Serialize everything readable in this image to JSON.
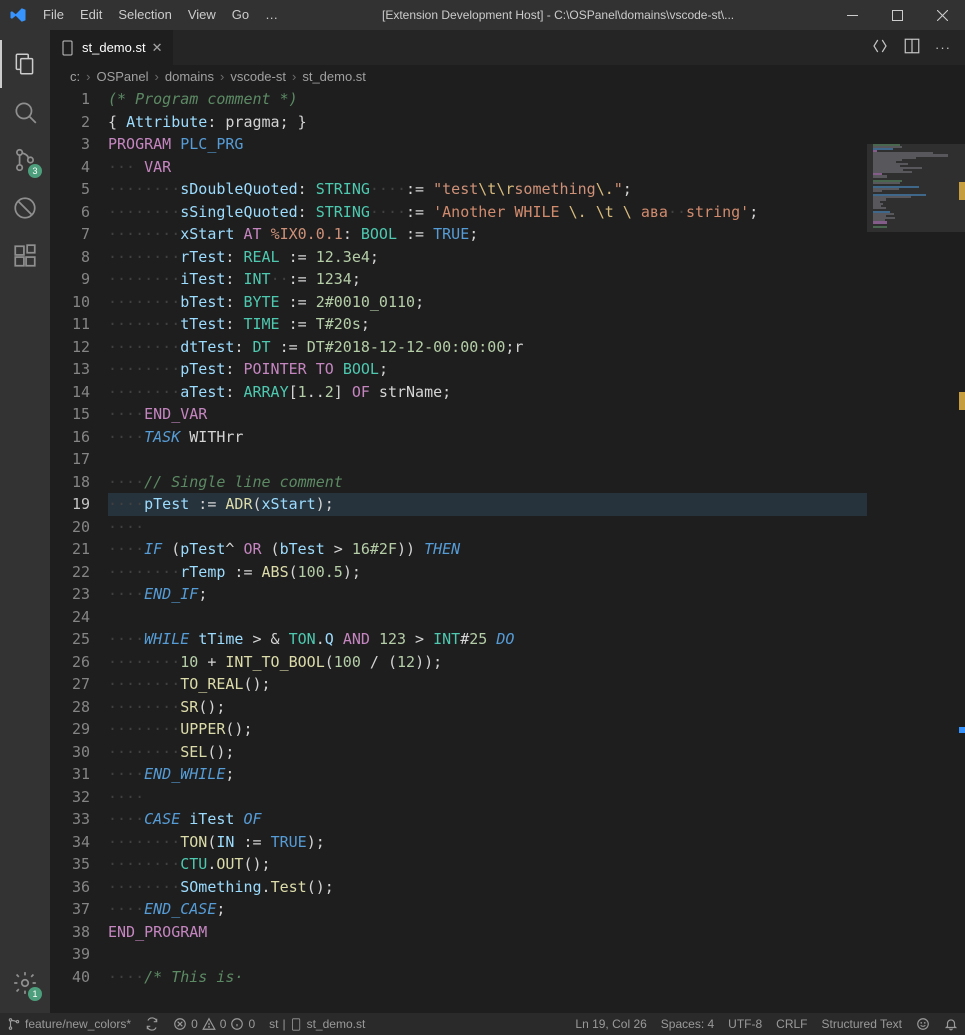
{
  "window": {
    "title": "[Extension Development Host] - C:\\OSPanel\\domains\\vscode-st\\..."
  },
  "menu": {
    "items": [
      "File",
      "Edit",
      "Selection",
      "View",
      "Go"
    ]
  },
  "activitybar": {
    "scm_badge": "3",
    "manage_badge": "1"
  },
  "tab": {
    "name": "st_demo.st"
  },
  "editor_actions": {
    "compare": "Compare changes",
    "split": "Split editor",
    "more": "More"
  },
  "breadcrumbs": [
    "c:",
    "OSPanel",
    "domains",
    "vscode-st",
    "st_demo.st"
  ],
  "code": {
    "lines": [
      {
        "n": 1,
        "raw": [
          [
            "c-comment",
            "(* Program comment *)"
          ]
        ]
      },
      {
        "n": 2,
        "raw": [
          [
            "c-punct",
            "{ "
          ],
          [
            "c-attr",
            "Attribute"
          ],
          [
            "c-punct",
            ": "
          ],
          [
            "c-white",
            "pragma"
          ],
          [
            "c-punct",
            "; }"
          ]
        ]
      },
      {
        "n": 3,
        "raw": [
          [
            "c-key",
            "PROGRAM "
          ],
          [
            "c-type",
            "PLC_PRG"
          ]
        ]
      },
      {
        "n": 4,
        "mod": "blue",
        "raw": [
          [
            "ws",
            "··· "
          ],
          [
            "c-key",
            "VAR"
          ]
        ]
      },
      {
        "n": 5,
        "raw": [
          [
            "ws",
            "········"
          ],
          [
            "c-var",
            "sDoubleQuoted"
          ],
          [
            "c-punct",
            ": "
          ],
          [
            "c-typecyan",
            "STRING"
          ],
          [
            "ws",
            "····"
          ],
          [
            "c-punct",
            ":= "
          ],
          [
            "c-str",
            "\""
          ],
          [
            "c-str",
            "test"
          ],
          [
            "c-esc",
            "\\t\\r"
          ],
          [
            "c-str",
            "something"
          ],
          [
            "c-esc",
            "\\."
          ],
          [
            "c-str",
            "\""
          ],
          [
            "c-punct",
            ";"
          ]
        ]
      },
      {
        "n": 6,
        "mod": "blue",
        "raw": [
          [
            "ws",
            "········"
          ],
          [
            "c-var",
            "sSingleQuoted"
          ],
          [
            "c-punct",
            ": "
          ],
          [
            "c-typecyan",
            "STRING"
          ],
          [
            "ws",
            "····"
          ],
          [
            "c-punct",
            ":= "
          ],
          [
            "c-strs",
            "'Another WHILE "
          ],
          [
            "c-esc",
            "\\."
          ],
          [
            "c-strs",
            " "
          ],
          [
            "c-esc",
            "\\t"
          ],
          [
            "c-strs",
            " "
          ],
          [
            "c-esc",
            "\\"
          ],
          [
            "c-strs",
            " ава"
          ],
          [
            "ws",
            "··"
          ],
          [
            "c-strs",
            "string'"
          ],
          [
            "c-punct",
            ";"
          ]
        ]
      },
      {
        "n": 7,
        "mod": "blue",
        "raw": [
          [
            "ws",
            "········"
          ],
          [
            "c-var",
            "xStart"
          ],
          [
            "c-white",
            " "
          ],
          [
            "c-key",
            "AT"
          ],
          [
            "c-white",
            " "
          ],
          [
            "c-addr",
            "%IX0.0.1"
          ],
          [
            "c-punct",
            ": "
          ],
          [
            "c-typecyan",
            "BOOL"
          ],
          [
            "c-punct",
            " := "
          ],
          [
            "c-type",
            "TRUE"
          ],
          [
            "c-punct",
            ";"
          ]
        ]
      },
      {
        "n": 8,
        "raw": [
          [
            "ws",
            "········"
          ],
          [
            "c-var",
            "rTest"
          ],
          [
            "c-punct",
            ": "
          ],
          [
            "c-typecyan",
            "REAL"
          ],
          [
            "c-punct",
            " := "
          ],
          [
            "c-num",
            "12.3e4"
          ],
          [
            "c-punct",
            ";"
          ]
        ]
      },
      {
        "n": 9,
        "raw": [
          [
            "ws",
            "········"
          ],
          [
            "c-var",
            "iTest"
          ],
          [
            "c-punct",
            ": "
          ],
          [
            "c-typecyan",
            "INT"
          ],
          [
            "ws",
            "··"
          ],
          [
            "c-punct",
            ":= "
          ],
          [
            "c-num",
            "1234"
          ],
          [
            "c-punct",
            ";"
          ]
        ]
      },
      {
        "n": 10,
        "mod": "blue",
        "raw": [
          [
            "ws",
            "········"
          ],
          [
            "c-var",
            "bTest"
          ],
          [
            "c-punct",
            ": "
          ],
          [
            "c-typecyan",
            "BYTE"
          ],
          [
            "c-punct",
            " := "
          ],
          [
            "c-num",
            "2#0010_0110"
          ],
          [
            "c-punct",
            ";"
          ]
        ]
      },
      {
        "n": 11,
        "raw": [
          [
            "ws",
            "········"
          ],
          [
            "c-var",
            "tTest"
          ],
          [
            "c-punct",
            ": "
          ],
          [
            "c-typecyan",
            "TIME"
          ],
          [
            "c-punct",
            " := "
          ],
          [
            "c-num",
            "T#20s"
          ],
          [
            "c-punct",
            ";"
          ]
        ]
      },
      {
        "n": 12,
        "mod": "blue",
        "raw": [
          [
            "ws",
            "········"
          ],
          [
            "c-var",
            "dtTest"
          ],
          [
            "c-punct",
            ": "
          ],
          [
            "c-typecyan",
            "DT"
          ],
          [
            "c-punct",
            " := "
          ],
          [
            "c-num",
            "DT#2018-12-12-00:00:00"
          ],
          [
            "c-punct",
            ";"
          ],
          [
            "c-white",
            "r"
          ]
        ]
      },
      {
        "n": 13,
        "raw": [
          [
            "ws",
            "········"
          ],
          [
            "c-var",
            "pTest"
          ],
          [
            "c-punct",
            ": "
          ],
          [
            "c-key",
            "POINTER TO"
          ],
          [
            "c-white",
            " "
          ],
          [
            "c-typecyan",
            "BOOL"
          ],
          [
            "c-punct",
            ";"
          ]
        ]
      },
      {
        "n": 14,
        "raw": [
          [
            "ws",
            "········"
          ],
          [
            "c-var",
            "aTest"
          ],
          [
            "c-punct",
            ": "
          ],
          [
            "c-typecyan",
            "ARRAY"
          ],
          [
            "c-punct",
            "["
          ],
          [
            "c-num",
            "1"
          ],
          [
            "c-punct",
            ".."
          ],
          [
            "c-num",
            "2"
          ],
          [
            "c-punct",
            "] "
          ],
          [
            "c-key",
            "OF"
          ],
          [
            "c-white",
            " strName"
          ],
          [
            "c-punct",
            ";"
          ]
        ]
      },
      {
        "n": 15,
        "raw": [
          [
            "ws",
            "····"
          ],
          [
            "c-key",
            "END_VAR"
          ]
        ]
      },
      {
        "n": 16,
        "mod": "blue",
        "raw": [
          [
            "ws",
            "····"
          ],
          [
            "c-kw2",
            "TASK"
          ],
          [
            "c-white",
            " WITHrr"
          ]
        ]
      },
      {
        "n": 17,
        "raw": []
      },
      {
        "n": 18,
        "raw": [
          [
            "ws",
            "····"
          ],
          [
            "c-comment",
            "// Single line comment"
          ]
        ]
      },
      {
        "n": 19,
        "active": true,
        "raw": [
          [
            "ws",
            "····"
          ],
          [
            "c-var",
            "pTest"
          ],
          [
            "c-punct",
            " := "
          ],
          [
            "c-fn",
            "ADR"
          ],
          [
            "c-punct",
            "("
          ],
          [
            "c-var",
            "xStart"
          ],
          [
            "c-punct",
            ");"
          ]
        ]
      },
      {
        "n": 20,
        "raw": [
          [
            "ws",
            "····"
          ]
        ]
      },
      {
        "n": 21,
        "raw": [
          [
            "ws",
            "····"
          ],
          [
            "c-kw2",
            "IF"
          ],
          [
            "c-punct",
            " ("
          ],
          [
            "c-var",
            "pTest"
          ],
          [
            "c-op",
            "^"
          ],
          [
            "c-white",
            " "
          ],
          [
            "c-key",
            "OR"
          ],
          [
            "c-punct",
            " ("
          ],
          [
            "c-var",
            "bTest"
          ],
          [
            "c-op",
            " > "
          ],
          [
            "c-num",
            "16#2F"
          ],
          [
            "c-punct",
            ")) "
          ],
          [
            "c-kw2",
            "THEN"
          ]
        ]
      },
      {
        "n": 22,
        "raw": [
          [
            "ws",
            "········"
          ],
          [
            "c-var",
            "rTemp"
          ],
          [
            "c-punct",
            " := "
          ],
          [
            "c-fn",
            "ABS"
          ],
          [
            "c-punct",
            "("
          ],
          [
            "c-num",
            "100.5"
          ],
          [
            "c-punct",
            ");"
          ]
        ]
      },
      {
        "n": 23,
        "raw": [
          [
            "ws",
            "····"
          ],
          [
            "c-kw2",
            "END_IF"
          ],
          [
            "c-punct",
            ";"
          ]
        ]
      },
      {
        "n": 24,
        "raw": []
      },
      {
        "n": 25,
        "raw": [
          [
            "ws",
            "····"
          ],
          [
            "c-kw2",
            "WHILE"
          ],
          [
            "c-white",
            " "
          ],
          [
            "c-var",
            "tTime"
          ],
          [
            "c-op",
            " > & "
          ],
          [
            "c-typecyan",
            "TON"
          ],
          [
            "c-punct",
            "."
          ],
          [
            "c-var",
            "Q"
          ],
          [
            "c-white",
            " "
          ],
          [
            "c-key",
            "AND"
          ],
          [
            "c-white",
            " "
          ],
          [
            "c-num",
            "123"
          ],
          [
            "c-op",
            " > "
          ],
          [
            "c-typecyan",
            "INT"
          ],
          [
            "c-punct",
            "#"
          ],
          [
            "c-num",
            "25"
          ],
          [
            "c-white",
            " "
          ],
          [
            "c-kw2",
            "DO"
          ]
        ]
      },
      {
        "n": 26,
        "raw": [
          [
            "ws",
            "········"
          ],
          [
            "c-num",
            "10"
          ],
          [
            "c-op",
            " + "
          ],
          [
            "c-fn",
            "INT_TO_BOOL"
          ],
          [
            "c-punct",
            "("
          ],
          [
            "c-num",
            "100"
          ],
          [
            "c-op",
            " / "
          ],
          [
            "c-punct",
            "("
          ],
          [
            "c-num",
            "12"
          ],
          [
            "c-punct",
            "));"
          ]
        ]
      },
      {
        "n": 27,
        "raw": [
          [
            "ws",
            "········"
          ],
          [
            "c-fn",
            "TO_REAL"
          ],
          [
            "c-punct",
            "();"
          ]
        ]
      },
      {
        "n": 28,
        "raw": [
          [
            "ws",
            "········"
          ],
          [
            "c-fn",
            "SR"
          ],
          [
            "c-punct",
            "();"
          ]
        ]
      },
      {
        "n": 29,
        "raw": [
          [
            "ws",
            "········"
          ],
          [
            "c-fn",
            "UPPER"
          ],
          [
            "c-punct",
            "();"
          ]
        ]
      },
      {
        "n": 30,
        "raw": [
          [
            "ws",
            "········"
          ],
          [
            "c-fn",
            "SEL"
          ],
          [
            "c-punct",
            "();"
          ]
        ]
      },
      {
        "n": 31,
        "raw": [
          [
            "ws",
            "····"
          ],
          [
            "c-kw2",
            "END_WHILE"
          ],
          [
            "c-punct",
            ";"
          ]
        ]
      },
      {
        "n": 32,
        "raw": [
          [
            "ws",
            "····"
          ]
        ]
      },
      {
        "n": 33,
        "raw": [
          [
            "ws",
            "····"
          ],
          [
            "c-kw2",
            "CASE"
          ],
          [
            "c-white",
            " "
          ],
          [
            "c-var",
            "iTest"
          ],
          [
            "c-white",
            " "
          ],
          [
            "c-kw2",
            "OF"
          ]
        ]
      },
      {
        "n": 34,
        "raw": [
          [
            "ws",
            "········"
          ],
          [
            "c-fn",
            "TON"
          ],
          [
            "c-punct",
            "("
          ],
          [
            "c-var",
            "IN"
          ],
          [
            "c-punct",
            " := "
          ],
          [
            "c-type",
            "TRUE"
          ],
          [
            "c-punct",
            ");"
          ]
        ]
      },
      {
        "n": 35,
        "raw": [
          [
            "ws",
            "········"
          ],
          [
            "c-typecyan",
            "CTU"
          ],
          [
            "c-punct",
            "."
          ],
          [
            "c-fn",
            "OUT"
          ],
          [
            "c-punct",
            "();"
          ]
        ]
      },
      {
        "n": 36,
        "mod": "blue",
        "raw": [
          [
            "ws",
            "········"
          ],
          [
            "c-var",
            "SOmething"
          ],
          [
            "c-punct",
            "."
          ],
          [
            "c-fn",
            "Test"
          ],
          [
            "c-punct",
            "();"
          ]
        ]
      },
      {
        "n": 37,
        "raw": [
          [
            "ws",
            "····"
          ],
          [
            "c-kw2",
            "END_CASE"
          ],
          [
            "c-punct",
            ";"
          ]
        ]
      },
      {
        "n": 38,
        "raw": [
          [
            "c-key",
            "END_PROGRAM"
          ]
        ]
      },
      {
        "n": 39,
        "raw": []
      },
      {
        "n": 40,
        "raw": [
          [
            "ws",
            "····"
          ],
          [
            "c-comment",
            "/* This is·"
          ]
        ]
      }
    ]
  },
  "statusbar": {
    "branch": "feature/new_colors*",
    "sync": "",
    "errors": "0",
    "warnings": "0",
    "info": "0",
    "ext_label": "st",
    "file_label": "st_demo.st",
    "position": "Ln 19, Col 26",
    "spaces": "Spaces: 4",
    "encoding": "UTF-8",
    "eol": "CRLF",
    "language": "Structured Text"
  }
}
